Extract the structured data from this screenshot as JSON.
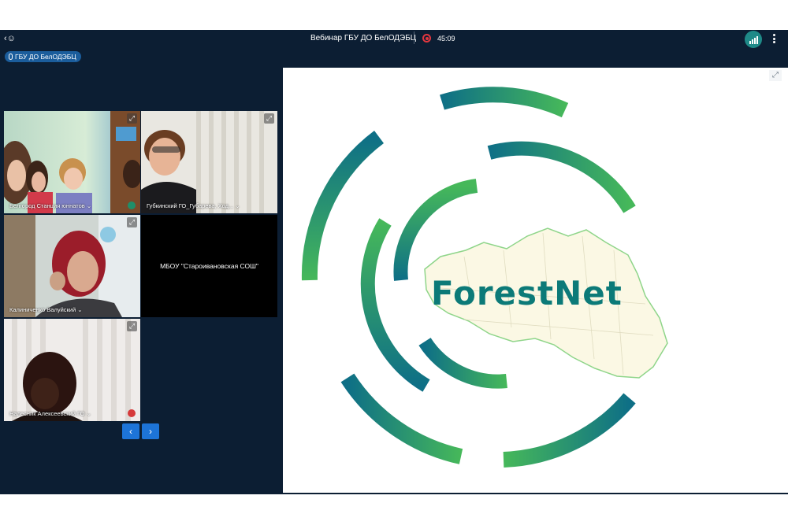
{
  "topbar": {
    "back_user_icon": "back-user-icon",
    "title": "Вебинар ГБУ ДО БелОДЭБЦ",
    "timer": "45:09",
    "record_color": "#e2373f",
    "signal_icon": "signal-bars-icon",
    "more_icon": "more-vertical-icon"
  },
  "org_chip": {
    "label": "ГБУ ДО БелОДЭБЦ",
    "icon": "mic-icon"
  },
  "participants": [
    {
      "name": "Белгород Станция юннатов",
      "caret": "⌄"
    },
    {
      "name": "Губкинский ГО_Губарева, Ход...",
      "caret": "⌄"
    },
    {
      "name": "Калиниченко Валуйский",
      "caret": "⌄"
    },
    {
      "name": "МБОУ \"Староивановская СОШ\""
    },
    {
      "name": "Налесник Алексеевский ГО",
      "caret": "⌄"
    }
  ],
  "pager": {
    "prev": "‹",
    "next": "›"
  },
  "slide": {
    "brand_text": "ForestNet",
    "colors": {
      "teal": "#0e6f86",
      "green": "#46b85a",
      "text": "#0c7a78",
      "map_fill": "#fbf8e4",
      "map_stroke": "#8fd58a"
    }
  },
  "colors": {
    "app_bg": "#0c1e33",
    "chip_bg": "#1b5d9c",
    "button_blue": "#1d74d8"
  }
}
